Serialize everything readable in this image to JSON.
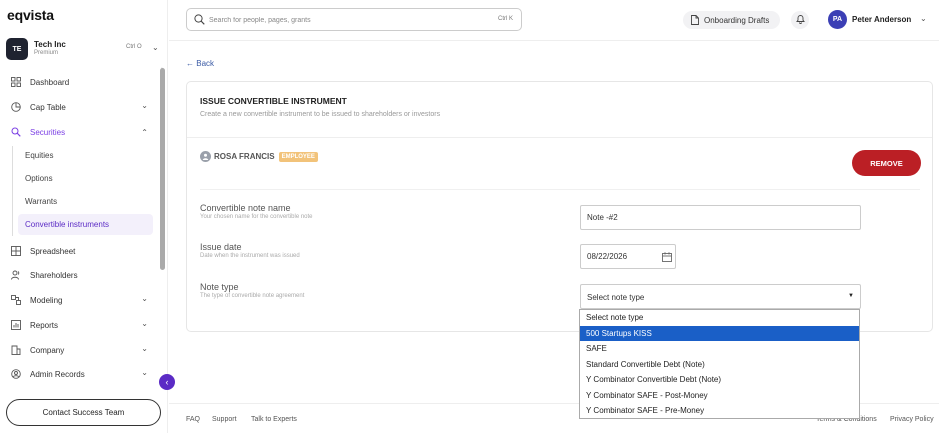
{
  "brand": "eqvista",
  "org": {
    "initials": "TE",
    "name": "Tech Inc",
    "plan": "Premium",
    "shortcut": "Ctrl O"
  },
  "sidebar": {
    "items": [
      {
        "label": "Dashboard",
        "icon": "dashboard-icon"
      },
      {
        "label": "Cap Table",
        "icon": "pie-chart-icon"
      },
      {
        "label": "Securities",
        "icon": "securities-icon"
      },
      {
        "label": "Spreadsheet",
        "icon": "grid-icon"
      },
      {
        "label": "Shareholders",
        "icon": "users-icon"
      },
      {
        "label": "Modeling",
        "icon": "modeling-icon"
      },
      {
        "label": "Reports",
        "icon": "reports-icon"
      },
      {
        "label": "Company",
        "icon": "company-icon"
      },
      {
        "label": "Admin Records",
        "icon": "admin-records-icon"
      }
    ],
    "sub_items": [
      "Equities",
      "Options",
      "Warrants",
      "Convertible instruments"
    ],
    "contact_label": "Contact Success Team"
  },
  "header": {
    "search_placeholder": "Search for people, pages, grants",
    "search_shortcut": "Ctrl K",
    "drafts_label": "Onboarding Drafts",
    "user_initials": "PA",
    "user_name": "Peter Anderson"
  },
  "main": {
    "back_label": "Back",
    "card_title": "ISSUE CONVERTIBLE INSTRUMENT",
    "card_subtitle": "Create a new convertible instrument to be issued to shareholders or investors",
    "holder_name": "ROSA FRANCIS",
    "holder_badge": "EMPLOYEE",
    "remove_label": "REMOVE",
    "fields": {
      "note_name": {
        "label": "Convertible note name",
        "hint": "Your chosen name for the convertible note",
        "value": "Note -#2"
      },
      "issue_date": {
        "label": "Issue date",
        "hint": "Date when the instrument was issued",
        "value": "08/22/2026"
      },
      "note_type": {
        "label": "Note type",
        "hint": "The type of convertible note agreement",
        "value": "Select note type"
      }
    },
    "note_type_options": [
      "Select note type",
      "500 Startups KISS",
      "SAFE",
      "Standard Convertible Debt (Note)",
      "Y Combinator Convertible Debt (Note)",
      "Y Combinator SAFE - Post-Money",
      "Y Combinator SAFE - Pre-Money"
    ],
    "highlighted_option": "500 Startups KISS"
  },
  "footer": {
    "links": [
      "FAQ",
      "Support",
      "Talk to Experts",
      "Terms & Conditions",
      "Privacy Policy"
    ]
  },
  "colors": {
    "accent": "#5b2bc5",
    "danger": "#bb1f25",
    "badge": "#f2c37a",
    "highlight": "#1a5fc7"
  }
}
